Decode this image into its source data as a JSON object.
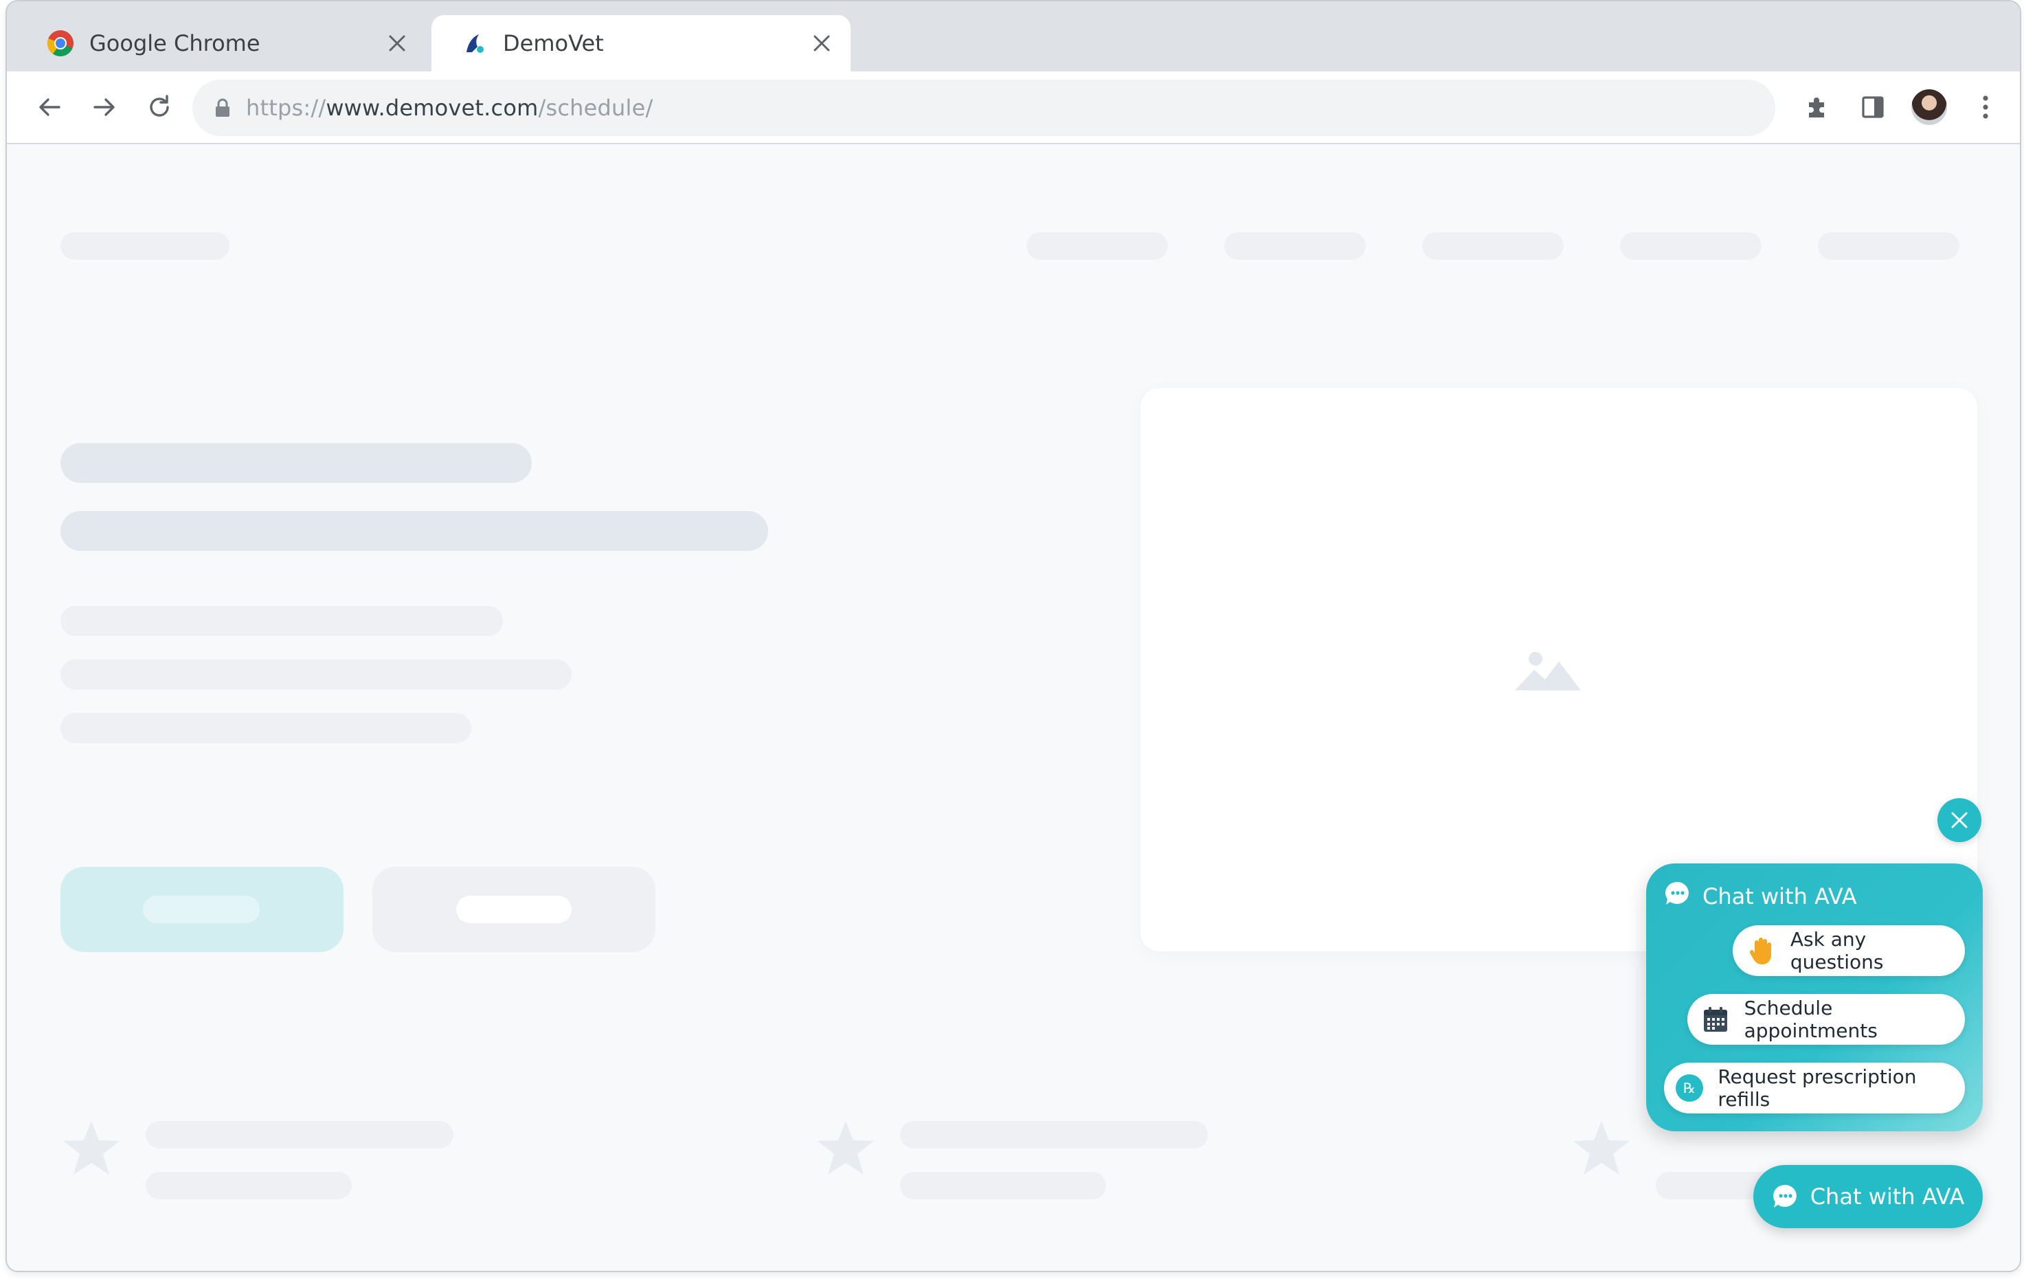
{
  "browser": {
    "tabs": [
      {
        "title": "Google Chrome",
        "active": false
      },
      {
        "title": "DemoVet",
        "active": true
      }
    ],
    "url": {
      "scheme": "https://",
      "host": "www.demovet.com",
      "path": "/schedule/"
    }
  },
  "chat_widget": {
    "panel_title": "Chat with AVA",
    "options": [
      {
        "label": "Ask any questions",
        "icon": "raised-hand-icon"
      },
      {
        "label": "Schedule appointments",
        "icon": "calendar-icon"
      },
      {
        "label": "Request prescription refills",
        "icon": "prescription-icon"
      }
    ],
    "launcher_label": "Chat with AVA"
  },
  "colors": {
    "accent": "#25bcc7",
    "chrome_tabstrip": "#dee1e6",
    "page_background": "#f8f9fb"
  }
}
